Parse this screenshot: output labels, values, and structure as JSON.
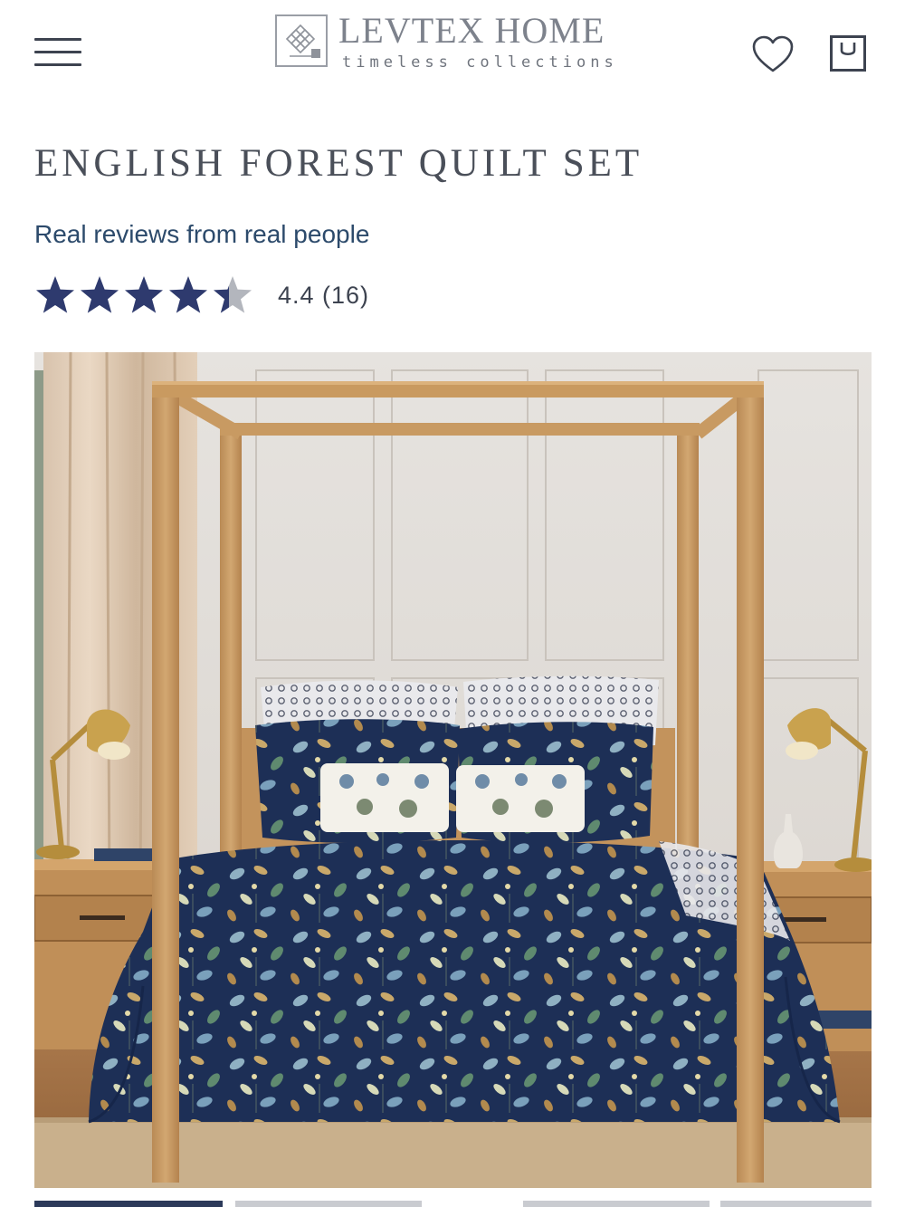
{
  "header": {
    "menu_icon": "hamburger-menu-icon",
    "logo": {
      "name": "LEVTEX HOME",
      "tagline": "timeless collections",
      "icon": "endless-knot-logo-icon"
    },
    "wishlist_icon": "heart-icon",
    "bag_icon": "shopping-bag-icon"
  },
  "product": {
    "title": "ENGLISH FOREST QUILT SET",
    "reviews_heading": "Real reviews from real people",
    "rating": {
      "value": 4.4,
      "count": 16,
      "display": "4.4 (16)",
      "max_stars": 5
    },
    "image": {
      "alt": "English Forest quilt set on a wooden canopy bed"
    }
  },
  "colors": {
    "star_filled": "#2e3a6e",
    "star_empty": "#b3b6bd",
    "heading_blue": "#2c4a6b",
    "text_dark": "#3d4350"
  },
  "gallery": {
    "thumbnail_count": 4,
    "active_index": 0
  }
}
